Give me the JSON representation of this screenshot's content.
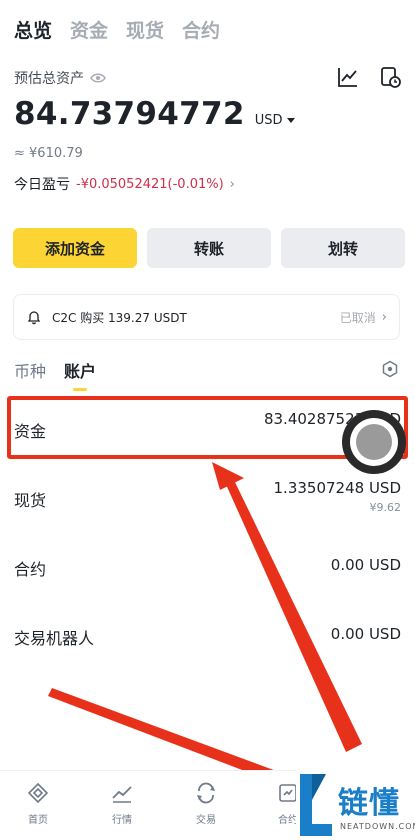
{
  "top_tabs": [
    {
      "label": "总览",
      "active": true
    },
    {
      "label": "资金",
      "active": false
    },
    {
      "label": "现货",
      "active": false
    },
    {
      "label": "合约",
      "active": false
    }
  ],
  "overview": {
    "est_label": "预估总资产",
    "balance": "84.73794772",
    "currency": "USD",
    "approx": "≈ ¥610.79",
    "pnl_label": "今日盈亏",
    "pnl_value": "-¥0.05052421(-0.01%)"
  },
  "actions": {
    "add_funds": "添加资金",
    "transfer": "转账",
    "move": "划转"
  },
  "notice": {
    "text": "C2C 购买 139.27 USDT",
    "status": "已取消"
  },
  "sub_tabs": [
    {
      "label": "币种",
      "active": false
    },
    {
      "label": "账户",
      "active": true
    }
  ],
  "accounts": [
    {
      "name": "资金",
      "value": "83.40287523 USD",
      "sub": ""
    },
    {
      "name": "现货",
      "value": "1.33507248 USD",
      "sub": "¥9.62"
    },
    {
      "name": "合约",
      "value": "0.00 USD",
      "sub": ""
    },
    {
      "name": "交易机器人",
      "value": "0.00 USD",
      "sub": ""
    }
  ],
  "bottom_nav": [
    {
      "label": "首页",
      "icon": "home-diamond-icon"
    },
    {
      "label": "行情",
      "icon": "market-chart-icon"
    },
    {
      "label": "交易",
      "icon": "trade-swap-icon"
    },
    {
      "label": "合约",
      "icon": "futures-icon"
    }
  ],
  "watermark": {
    "logo_letter": "L",
    "text": "链懂",
    "sub": "NEATDOWN.COM"
  },
  "colors": {
    "brand_yellow": "#fcd535",
    "loss_red": "#cf304a",
    "annotation_red": "#e8311a",
    "watermark_blue": "#1a7fc8"
  }
}
